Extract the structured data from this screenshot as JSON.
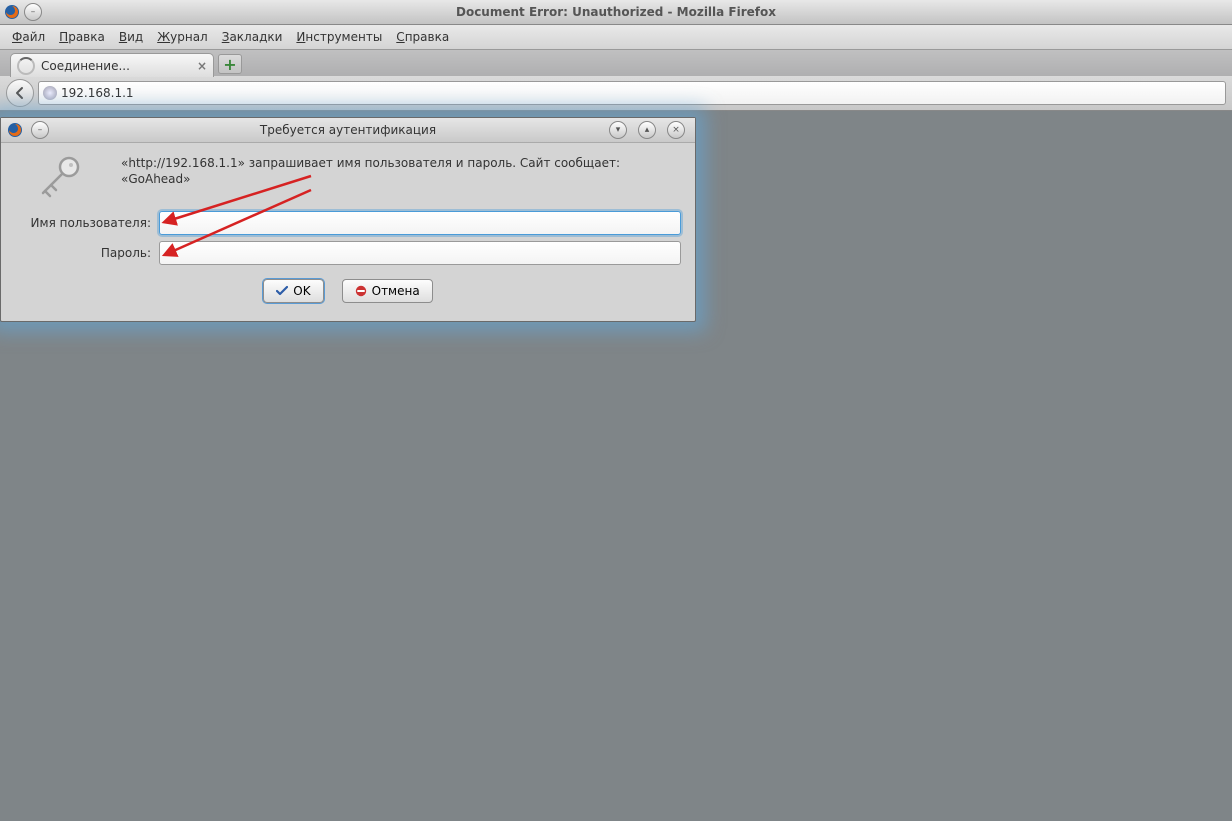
{
  "window": {
    "title": "Document Error: Unauthorized - Mozilla Firefox"
  },
  "menubar": {
    "file": "Файл",
    "edit": "Правка",
    "view": "Вид",
    "log": "Журнал",
    "bookmarks": "Закладки",
    "tools": "Инструменты",
    "help": "Справка"
  },
  "tabs": {
    "active_label": "Соединение..."
  },
  "urlbar": {
    "value": "192.168.1.1"
  },
  "dialog": {
    "title": "Требуется аутентификация",
    "message": "«http://192.168.1.1» запрашивает имя пользователя и пароль. Сайт сообщает: «GoAhead»",
    "username_label": "Имя пользователя:",
    "password_label": "Пароль:",
    "username_value": "",
    "password_value": "",
    "ok_label": "OK",
    "cancel_label": "Отмена"
  }
}
